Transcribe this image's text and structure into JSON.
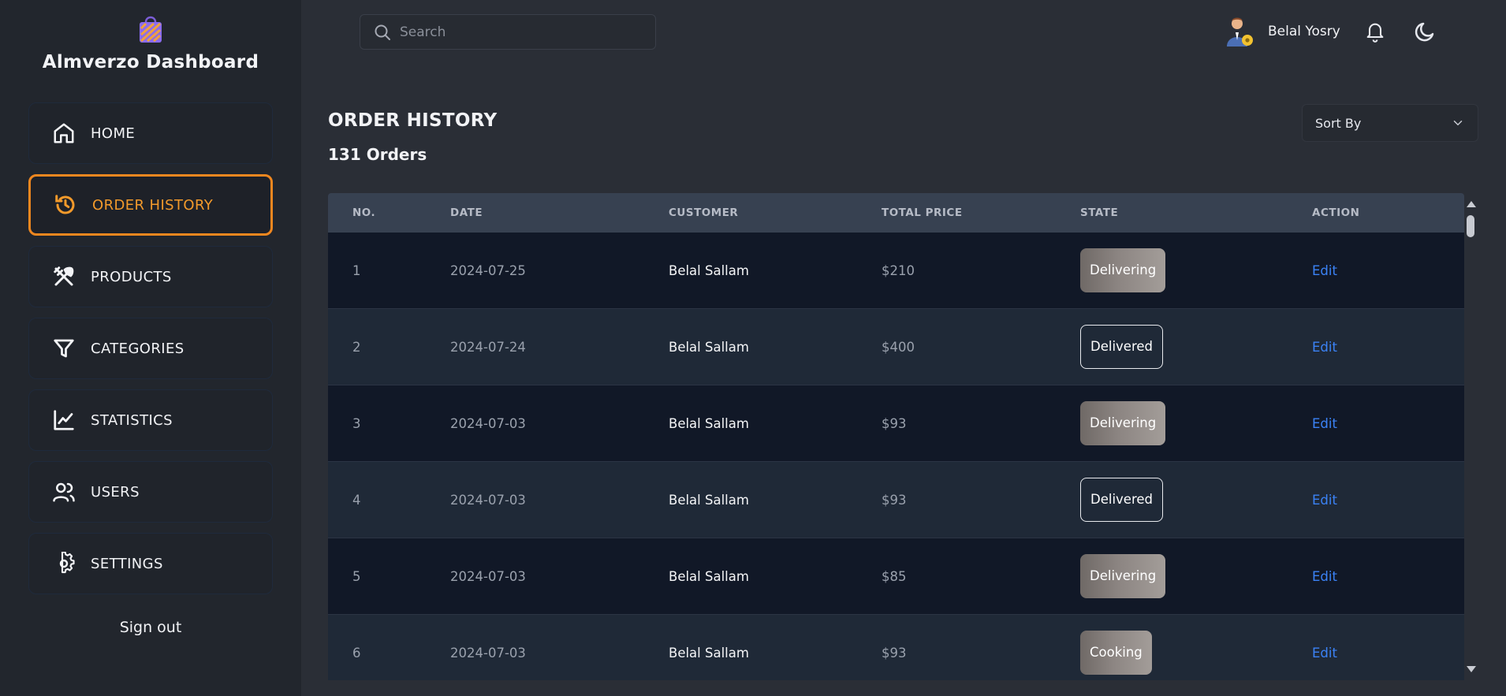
{
  "brand": {
    "title": "Almverzo Dashboard",
    "logo_icon": "shopping-bag-icon"
  },
  "sidebar": {
    "items": [
      {
        "label": "HOME",
        "icon": "home-icon",
        "active": false
      },
      {
        "label": "ORDER HISTORY",
        "icon": "history-icon",
        "active": true
      },
      {
        "label": "PRODUCTS",
        "icon": "utensils-icon",
        "active": false
      },
      {
        "label": "CATEGORIES",
        "icon": "filter-icon",
        "active": false
      },
      {
        "label": "STATISTICS",
        "icon": "chart-line-icon",
        "active": false
      },
      {
        "label": "USERS",
        "icon": "users-icon",
        "active": false
      },
      {
        "label": "SETTINGS",
        "icon": "gear-icon",
        "active": false
      }
    ],
    "signout_label": "Sign out"
  },
  "header": {
    "search_placeholder": "Search",
    "user_name": "Belal Yosry"
  },
  "main": {
    "title": "ORDER HISTORY",
    "order_count": "131 Orders",
    "sort_label": "Sort By"
  },
  "table": {
    "columns": [
      "NO.",
      "DATE",
      "CUSTOMER",
      "TOTAL PRICE",
      "STATE",
      "ACTION"
    ],
    "rows": [
      {
        "no": "1",
        "date": "2024-07-25",
        "customer": "Belal Sallam",
        "price": "$210",
        "state": "Delivering",
        "action": "Edit"
      },
      {
        "no": "2",
        "date": "2024-07-24",
        "customer": "Belal Sallam",
        "price": "$400",
        "state": "Delivered",
        "action": "Edit"
      },
      {
        "no": "3",
        "date": "2024-07-03",
        "customer": "Belal Sallam",
        "price": "$93",
        "state": "Delivering",
        "action": "Edit"
      },
      {
        "no": "4",
        "date": "2024-07-03",
        "customer": "Belal Sallam",
        "price": "$93",
        "state": "Delivered",
        "action": "Edit"
      },
      {
        "no": "5",
        "date": "2024-07-03",
        "customer": "Belal Sallam",
        "price": "$85",
        "state": "Delivering",
        "action": "Edit"
      },
      {
        "no": "6",
        "date": "2024-07-03",
        "customer": "Belal Sallam",
        "price": "$93",
        "state": "Cooking",
        "action": "Edit"
      }
    ]
  },
  "colors": {
    "accent": "#f0871f",
    "link": "#3b82f6",
    "background": "#2a2e36",
    "sidebar": "#22262d"
  }
}
